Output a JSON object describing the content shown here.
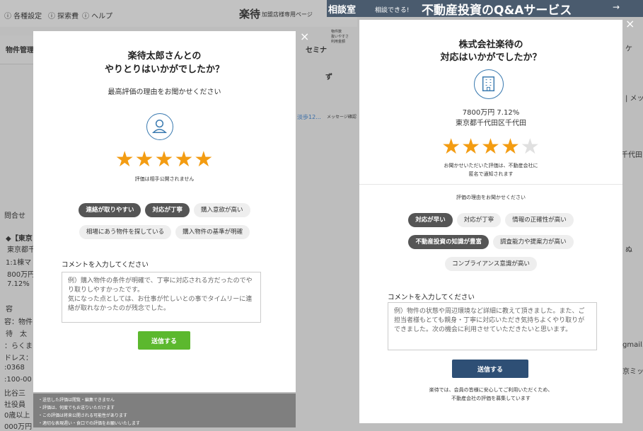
{
  "background": {
    "topbar_items": [
      "ⓘ 各種設定",
      "ⓘ 探索費",
      "ⓘ ヘルプ"
    ],
    "brand_text": "楽待",
    "brand_sub": "加盟店様専用ページ",
    "left_labels": {
      "property": "物件管理",
      "inquiry": "問合せ",
      "bracket": "◆【東京",
      "tokyo": "東京都千",
      "one_bldg": "1:1棟マ",
      "amount": "800万円",
      "percent": "7.12%",
      "content": "容",
      "content2": "容：物件",
      "tai": "待　太",
      "raku": "：らくま",
      "address": "ドレス：",
      "num1": ":0368",
      "num2": ":100-00",
      "shi": "比谷三",
      "yaku": "社役員",
      "age": "0歳以上",
      "man": "000万円"
    },
    "middle_labels": {
      "tep": "淡歩12...",
      "mess": "メッセージ確認",
      "sem": "セミナ",
      "zu": "ず"
    },
    "banner": {
      "chip": "相談室",
      "text": "相談できる!",
      "title": "不動産投資のQ&Aサービス",
      "arrow": "→"
    },
    "right_bg_labels": {
      "mess": "| メッ",
      "chiyoda": "千代田区",
      "mail": "gmail.c",
      "kyoto": "京ミッ",
      "ke": "ケ",
      "nu": "ぬ"
    },
    "notes": [
      "・送信した評価は閲覧・編集できません",
      "・評価は、何度でもお送りいただけます",
      "・この評価は将来公開される可能性があります",
      "・適切な表現週い・食口での評価をお願いいたします"
    ],
    "tiny_label": "物件数\n抜いやすさ\n利用金額"
  },
  "left_modal": {
    "title_line1": "楽待太郎さんとの",
    "title_line2": "やりとりはいかがでしたか？",
    "subtitle": "最高評価の理由をお聞かせください",
    "rating": 5,
    "stars": [
      "★",
      "★",
      "★",
      "★",
      "★"
    ],
    "rating_note": "評価は相手公開されません",
    "chips": [
      {
        "label": "連絡が取りやすい",
        "selected": true
      },
      {
        "label": "対応が丁寧",
        "selected": true
      },
      {
        "label": "購入意欲が高い",
        "selected": false
      },
      {
        "label": "相場にあう物件を探している",
        "selected": false
      },
      {
        "label": "購入物件の基準が明確",
        "selected": false
      }
    ],
    "comment_label": "コメントを入力してください",
    "comment_placeholder": "例）購入物件の条件が明確で、丁寧に対応される方だったのでやり取りしやすかったです。\n気になった点としては、お仕事が忙しいとの事でタイムリーに連絡が取れなかったのが残念でした。",
    "submit_label": "送信する",
    "close": "×",
    "accent": "#5cb82e"
  },
  "right_modal": {
    "title_line1": "株式会社楽待の",
    "title_line2": "対応はいかがでしたか？",
    "property_price": "7800万円 7.12%",
    "property_address": "東京都千代田区千代田",
    "rating": 4,
    "stars": [
      "★",
      "★",
      "★",
      "★",
      "★"
    ],
    "rating_note_line1": "お聞かせいただいた評価は、不動産会社に",
    "rating_note_line2": "匿名で通知されます",
    "reason_prompt": "評価の理由をお聞かせください",
    "chips": [
      {
        "label": "対応が早い",
        "selected": true
      },
      {
        "label": "対応が丁寧",
        "selected": false
      },
      {
        "label": "情報の正確性が高い",
        "selected": false
      },
      {
        "label": "不動産投資の知識が豊富",
        "selected": true
      },
      {
        "label": "調査能力や提案力が高い",
        "selected": false
      },
      {
        "label": "コンプライアンス意識が高い",
        "selected": false
      }
    ],
    "comment_label": "コメントを入力してください",
    "comment_placeholder": "例）物件の状態や周辺環境など詳細に教えて頂きました。また、ご担当者様もとても親身・丁寧に対応いただき気持ちよくやり取りができました。次の機会に利用させていただきたいと思います。",
    "submit_label": "送信する",
    "footer_line1": "楽待では、会員の皆様に安心してご利用いただくため、",
    "footer_line2": "不動産会社の評価を募集しています",
    "close": "×",
    "accent": "#2e4f75"
  }
}
